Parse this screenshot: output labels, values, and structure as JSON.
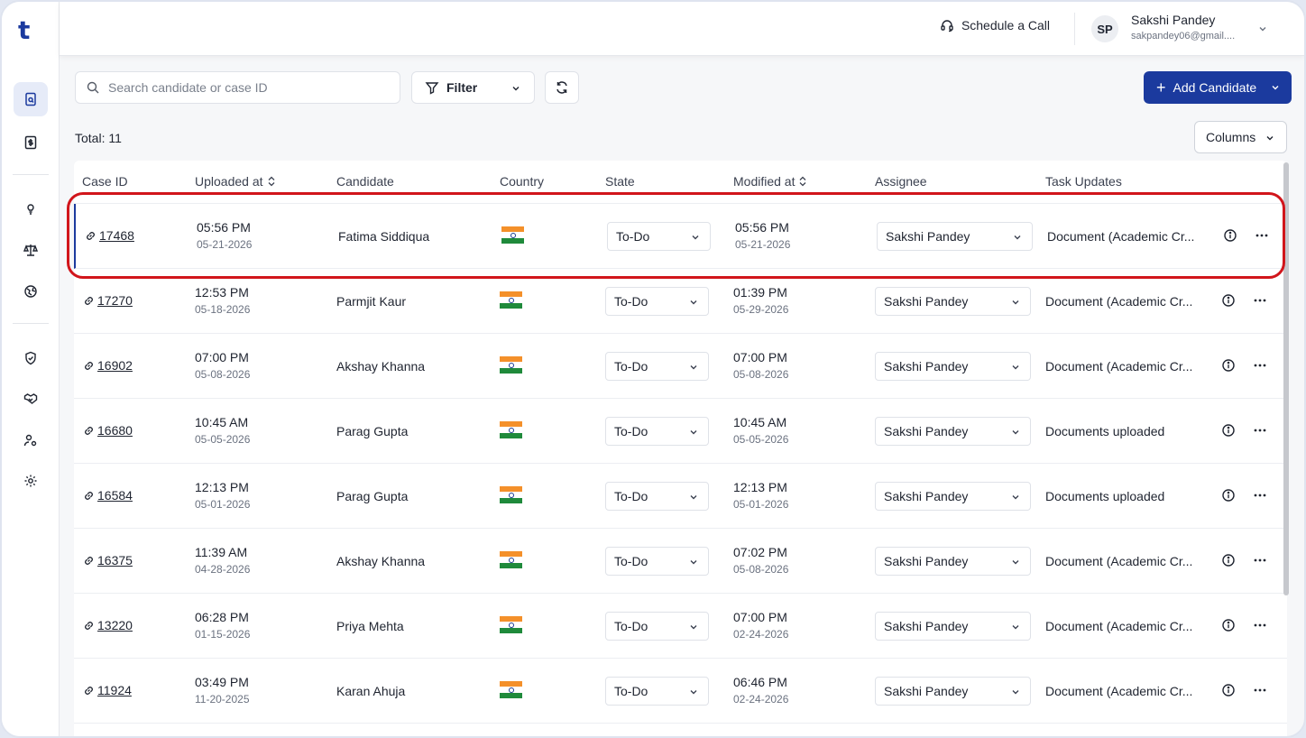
{
  "app": {
    "logo_letter": "t",
    "brand_color": "#1b3a9e"
  },
  "sidebar": {
    "icons": [
      "document-search-icon",
      "dollar-document-icon",
      "lightbulb-icon",
      "scales-icon",
      "globe-icon",
      "shield-check-icon",
      "handshake-icon",
      "user-settings-icon",
      "gear-icon"
    ],
    "active": "document-search-icon"
  },
  "topbar": {
    "schedule_label": "Schedule a Call",
    "user": {
      "initials": "SP",
      "name": "Sakshi Pandey",
      "email": "sakpandey06@gmail...."
    }
  },
  "toolbar": {
    "search_placeholder": "Search candidate or case ID",
    "filter_label": "Filter",
    "add_label": "Add Candidate",
    "columns_label": "Columns",
    "total_text": "Total: 11"
  },
  "table": {
    "headers": {
      "case_id": "Case ID",
      "uploaded_at": "Uploaded at",
      "candidate": "Candidate",
      "country": "Country",
      "state": "State",
      "modified_at": "Modified at",
      "assignee": "Assignee",
      "task_updates": "Task Updates"
    },
    "rows": [
      {
        "case_id": "17468",
        "uploaded_time": "05:56 PM",
        "uploaded_date": "05-21-2026",
        "candidate": "Fatima Siddiqua",
        "country": "India",
        "state": "To-Do",
        "modified_time": "05:56 PM",
        "modified_date": "05-21-2026",
        "assignee": "Sakshi Pandey",
        "task": "Document (Academic Cr..."
      },
      {
        "case_id": "17270",
        "uploaded_time": "12:53 PM",
        "uploaded_date": "05-18-2026",
        "candidate": "Parmjit Kaur",
        "country": "India",
        "state": "To-Do",
        "modified_time": "01:39 PM",
        "modified_date": "05-29-2026",
        "assignee": "Sakshi Pandey",
        "task": "Document (Academic Cr..."
      },
      {
        "case_id": "16902",
        "uploaded_time": "07:00 PM",
        "uploaded_date": "05-08-2026",
        "candidate": "Akshay Khanna",
        "country": "India",
        "state": "To-Do",
        "modified_time": "07:00 PM",
        "modified_date": "05-08-2026",
        "assignee": "Sakshi Pandey",
        "task": "Document (Academic Cr..."
      },
      {
        "case_id": "16680",
        "uploaded_time": "10:45 AM",
        "uploaded_date": "05-05-2026",
        "candidate": "Parag Gupta",
        "country": "India",
        "state": "To-Do",
        "modified_time": "10:45 AM",
        "modified_date": "05-05-2026",
        "assignee": "Sakshi Pandey",
        "task": "Documents uploaded"
      },
      {
        "case_id": "16584",
        "uploaded_time": "12:13 PM",
        "uploaded_date": "05-01-2026",
        "candidate": "Parag Gupta",
        "country": "India",
        "state": "To-Do",
        "modified_time": "12:13 PM",
        "modified_date": "05-01-2026",
        "assignee": "Sakshi Pandey",
        "task": "Documents uploaded"
      },
      {
        "case_id": "16375",
        "uploaded_time": "11:39 AM",
        "uploaded_date": "04-28-2026",
        "candidate": "Akshay Khanna",
        "country": "India",
        "state": "To-Do",
        "modified_time": "07:02 PM",
        "modified_date": "05-08-2026",
        "assignee": "Sakshi Pandey",
        "task": "Document (Academic Cr..."
      },
      {
        "case_id": "13220",
        "uploaded_time": "06:28 PM",
        "uploaded_date": "01-15-2026",
        "candidate": "Priya Mehta",
        "country": "India",
        "state": "To-Do",
        "modified_time": "07:00 PM",
        "modified_date": "02-24-2026",
        "assignee": "Sakshi Pandey",
        "task": "Document (Academic Cr..."
      },
      {
        "case_id": "11924",
        "uploaded_time": "03:49 PM",
        "uploaded_date": "11-20-2025",
        "candidate": "Karan Ahuja",
        "country": "India",
        "state": "To-Do",
        "modified_time": "06:46 PM",
        "modified_date": "02-24-2026",
        "assignee": "Sakshi Pandey",
        "task": "Document (Academic Cr..."
      }
    ]
  },
  "highlight": {
    "color": "#d1151b",
    "target_row_case_id": "17468"
  }
}
